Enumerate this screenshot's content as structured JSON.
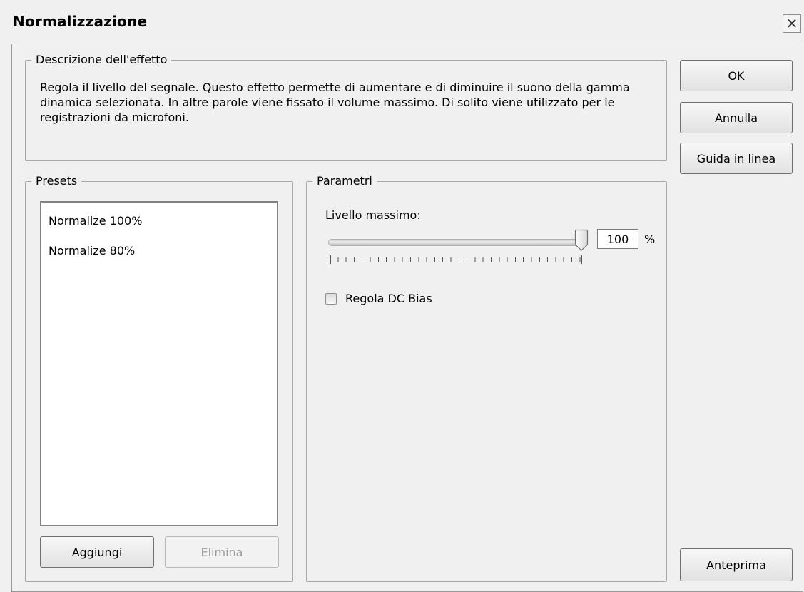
{
  "window": {
    "title": "Normalizzazione",
    "close_icon": "close-icon"
  },
  "description": {
    "legend": "Descrizione dell'effetto",
    "text": "Regola il livello del segnale. Questo effetto permette di aumentare e di diminuire il suono della gamma dinamica selezionata. In altre parole viene fissato il volume massimo.  Di solito viene utilizzato per le registrazioni da microfoni."
  },
  "buttons": {
    "ok": "OK",
    "cancel": "Annulla",
    "help": "Guida in linea",
    "preview": "Anteprima"
  },
  "presets": {
    "legend": "Presets",
    "items": [
      "Normalize 100%",
      "Normalize 80%"
    ],
    "add_label": "Aggiungi",
    "delete_label": "Elimina"
  },
  "parameters": {
    "legend": "Parametri",
    "max_level_label": "Livello massimo:",
    "max_level_value": "100",
    "max_level_unit": "%",
    "slider_fraction": 1.0,
    "dc_bias_label": "Regola DC Bias",
    "dc_bias_checked": false
  }
}
